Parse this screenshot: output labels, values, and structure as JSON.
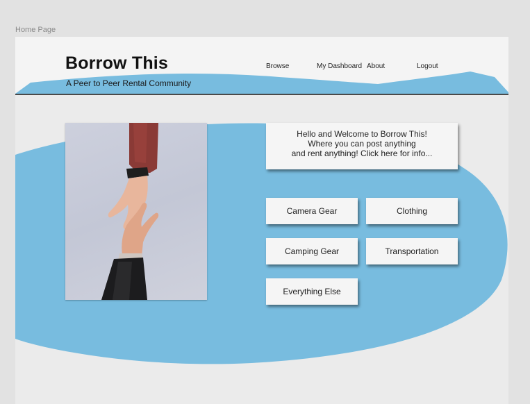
{
  "page_label": "Home Page",
  "brand": {
    "title": "Borrow This",
    "subtitle": "A Peer to Peer Rental Community"
  },
  "nav": {
    "browse": "Browse",
    "dashboard": "My Dashboard",
    "about": "About",
    "logout": "Logout"
  },
  "welcome": {
    "line1": "Hello and Welcome to Borrow This!",
    "line2": "Where you can post anything",
    "line3": "and rent anything!  Click here for info..."
  },
  "categories": {
    "camera": "Camera Gear",
    "clothing": "Clothing",
    "camping": "Camping Gear",
    "transportation": "Transportation",
    "everything": "Everything Else"
  },
  "colors": {
    "accent_blue": "#78bcdf",
    "background": "#ebebeb",
    "card": "#f5f5f5"
  }
}
